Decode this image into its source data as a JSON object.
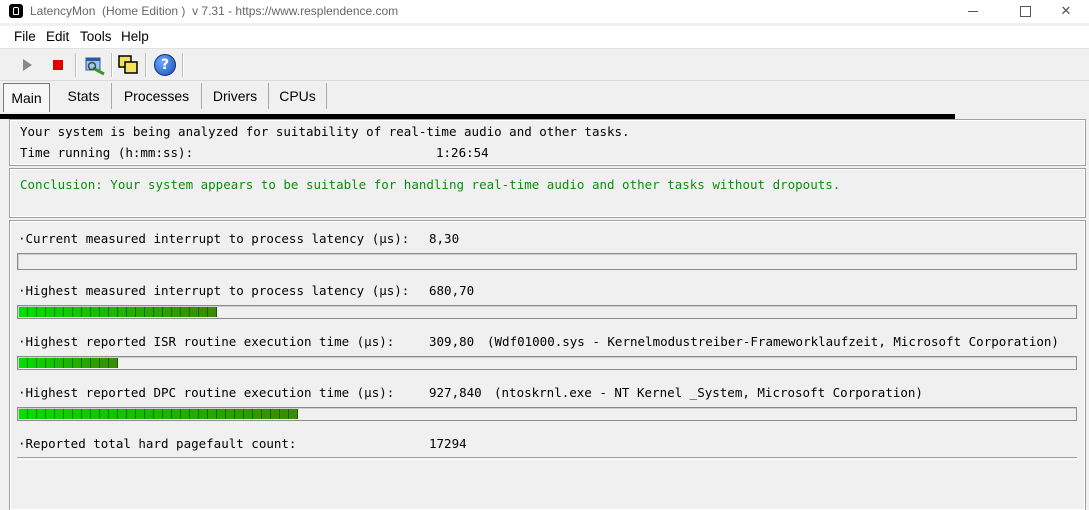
{
  "window": {
    "title": "LatencyMon  (Home Edition )  v 7.31 - https://www.resplendence.com"
  },
  "menu": [
    "File",
    "Edit",
    "Tools",
    "Help"
  ],
  "toolbar": {
    "buttons": [
      "play-icon",
      "stop-icon",
      "analyze-icon",
      "windows-icon",
      "help-icon"
    ],
    "help_symbol": "?"
  },
  "tabs": [
    "Main",
    "Stats",
    "Processes",
    "Drivers",
    "CPUs"
  ],
  "status": {
    "line1": "Your system is being analyzed for suitability of real-time audio and other tasks.",
    "time_label": "Time running (h:mm:ss):",
    "time_value": "1:26:54"
  },
  "conclusion": "Conclusion: Your system appears to be suitable for handling real-time audio and other tasks without dropouts.",
  "metrics": [
    {
      "label": "·Current measured interrupt to process latency (µs):",
      "value": "8,30",
      "detail": "",
      "bar_level": 0.0
    },
    {
      "label": "·Highest measured interrupt to process latency (µs):",
      "value": "680,70",
      "detail": "",
      "bar_level": 0.19
    },
    {
      "label": "·Highest reported ISR routine execution time (µs):",
      "value": "309,80",
      "detail": "(Wdf01000.sys - Kernelmodustreiber-Frameworklaufzeit, Microsoft Corporation)",
      "bar_level": 0.09
    },
    {
      "label": "·Highest reported DPC routine execution time (µs):",
      "value": "927,840",
      "detail": "(ntoskrnl.exe - NT Kernel _System, Microsoft Corporation)",
      "bar_level": 0.26
    },
    {
      "label": "·Reported total hard pagefault count:",
      "value": "17294",
      "detail": ""
    }
  ],
  "colors": {
    "conclusion": "#0a8f0a",
    "bar_green": "#00e000",
    "bar_dark": "#3c8a00"
  }
}
